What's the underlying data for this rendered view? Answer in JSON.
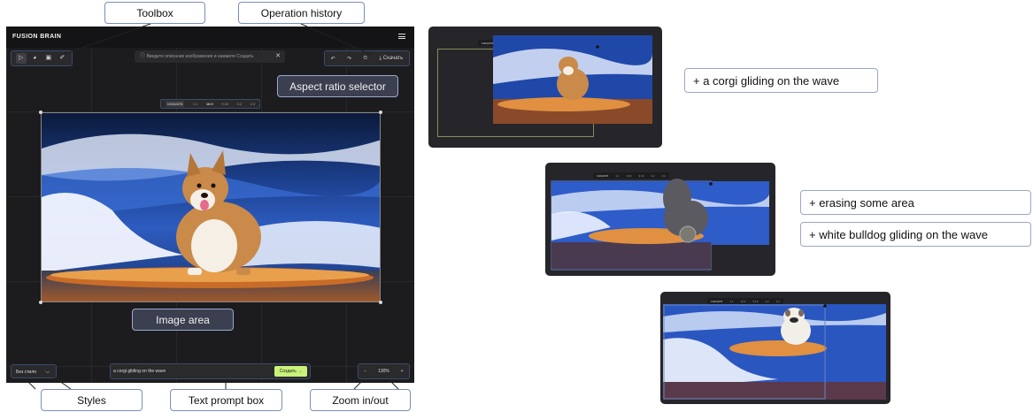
{
  "app": {
    "logo": "FUSION BRAIN",
    "hint_text": "Введите описание изображения и нажмите Создать",
    "hint_close": "✕",
    "toolbox_icons": [
      "cursor-icon",
      "brush-icon",
      "image-icon",
      "eraser-icon"
    ],
    "history": {
      "undo": "↶",
      "redo": "↷",
      "history": "⏲",
      "download_icon": "⤓",
      "download_label": "Скачать"
    },
    "aspect_ratios": [
      "1024x576",
      "1:1",
      "16:9",
      "9:16",
      "3:2",
      "2:3"
    ],
    "aspect_selected": "16:9",
    "styles_label": "Без стиля",
    "prompt_value": "a corgi gliding on the wave",
    "create_label": "Создать",
    "zoom": {
      "minus": "−",
      "value": "130%",
      "plus": "+"
    }
  },
  "callouts": {
    "toolbox": "Toolbox",
    "history": "Operation history",
    "aspect": "Aspect ratio selector",
    "image_area": "Image area",
    "styles": "Styles",
    "prompt": "Text prompt box",
    "zoom": "Zoom in/out"
  },
  "steps": {
    "step1": "+ a corgi gliding on the wave",
    "step2a": "+ erasing some area",
    "step2b": "+ white bulldog gliding on the wave"
  },
  "colors": {
    "accent_green": "#c9f27a",
    "app_bg": "#1c1c1e",
    "callout_border": "#7a8eb8"
  }
}
